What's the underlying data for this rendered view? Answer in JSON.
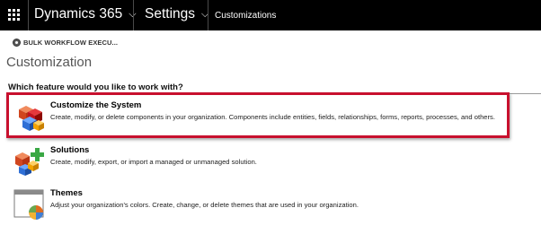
{
  "navbar": {
    "app_title": "Dynamics 365",
    "app_chevron": "⌵",
    "settings_label": "Settings",
    "settings_chevron": "⌵",
    "breadcrumb": "Customizations"
  },
  "command_bar": {
    "bulk_workflow_label": "BULK WORKFLOW EXECU..."
  },
  "page": {
    "title": "Customization",
    "question": "Which feature would you like to work with?"
  },
  "features": [
    {
      "title": "Customize the System",
      "description": "Create, modify, or delete components in your organization. Components include entities, fields, relationships, forms, reports, processes, and others.",
      "icon": "customize-system-icon"
    },
    {
      "title": "Solutions",
      "description": "Create, modify, export, or import a managed or unmanaged solution.",
      "icon": "solutions-icon"
    },
    {
      "title": "Themes",
      "description": "Adjust your organization's colors. Create, change, or delete themes that are used in your organization.",
      "icon": "themes-icon"
    }
  ],
  "colors": {
    "navbar_bg": "#000000",
    "highlight_border": "#c8102e"
  }
}
